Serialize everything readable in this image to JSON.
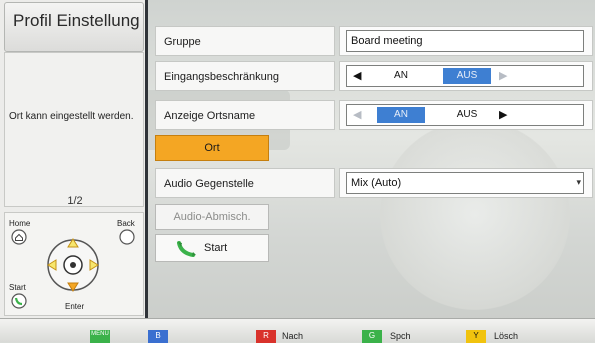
{
  "left": {
    "title": "Profil Einstellung",
    "info_text": "Ort kann eingestellt werden.",
    "page_indicator": "1/2",
    "remote": {
      "home": "Home",
      "back": "Back",
      "start": "Start",
      "enter": "Enter"
    }
  },
  "form": {
    "gruppe_label": "Gruppe",
    "gruppe_value": "Board meeting",
    "eingang_label": "Eingangsbeschränkung",
    "eingang_on": "AN",
    "eingang_off": "AUS",
    "eingang_selected": "AUS",
    "anzeige_label": "Anzeige Ortsname",
    "anzeige_on": "AN",
    "anzeige_off": "AUS",
    "anzeige_selected": "AN",
    "ort_button": "Ort",
    "audio_label": "Audio Gegenstelle",
    "audio_value": "Mix (Auto)",
    "abmisch_button": "Audio-Abmisch.",
    "start_button": "Start"
  },
  "bottom": {
    "menu_key": "MENU",
    "b_key": "B",
    "r_key": "R",
    "r_label": "Nach",
    "g_key": "G",
    "g_label": "Spch",
    "y_key": "Y",
    "y_label": "Lösch"
  },
  "colors": {
    "accent_orange": "#f4a623",
    "toggle_selected": "#3e7fd2",
    "key_green": "#3bb24a",
    "key_blue": "#3a6fd0",
    "key_red": "#d9322b",
    "key_yellow": "#f1c30e"
  }
}
